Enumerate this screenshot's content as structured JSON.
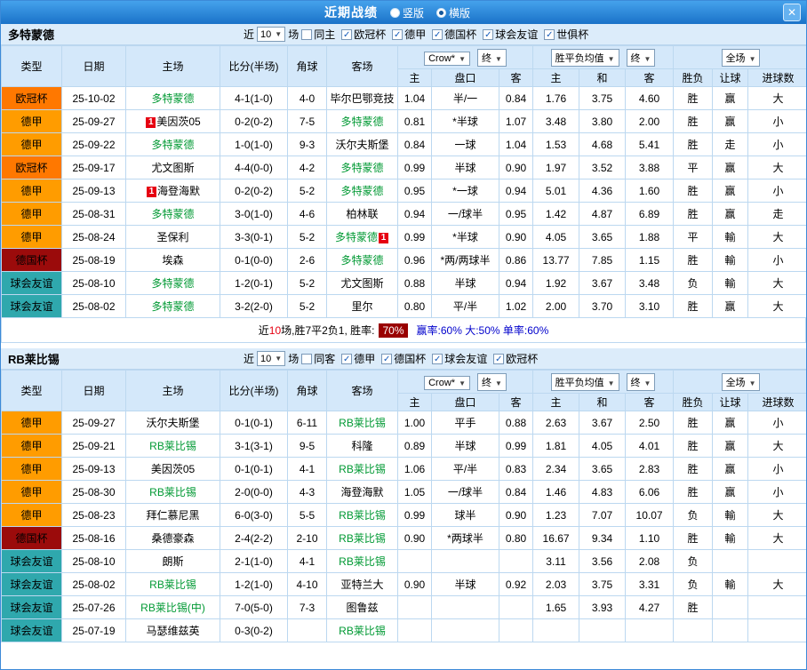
{
  "window": {
    "title": "近期战绩",
    "close_label": "✕",
    "view_options": [
      {
        "label": "竖版",
        "selected": false
      },
      {
        "label": "横版",
        "selected": true
      }
    ]
  },
  "league_colors": {
    "欧冠杯": "#ff7800",
    "德甲": "#ff9c00",
    "德国杯": "#9b0b0b",
    "球会友谊": "#2fa8ad"
  },
  "columns": [
    "类型",
    "日期",
    "主场",
    "比分(半场)",
    "角球",
    "客场",
    "主",
    "盘口",
    "客",
    "主",
    "和",
    "客",
    "胜负",
    "让球",
    "进球数"
  ],
  "dropdowns": [
    "Crow*",
    "终",
    "胜平负均值",
    "终",
    "全场"
  ],
  "filter": {
    "near_label": "近",
    "count": "10",
    "games_label": "场"
  },
  "sections": [
    {
      "team": "多特蒙德",
      "filters": [
        {
          "label": "同主",
          "checked": false
        },
        {
          "label": "欧冠杯",
          "checked": true
        },
        {
          "label": "德甲",
          "checked": true
        },
        {
          "label": "德国杯",
          "checked": true
        },
        {
          "label": "球会友谊",
          "checked": true
        },
        {
          "label": "世俱杯",
          "checked": true
        }
      ],
      "rows": [
        {
          "league": "欧冠杯",
          "date": "25-10-02",
          "home": {
            "name": "多特蒙德",
            "focus": true
          },
          "score": "4-1(1-0)",
          "corners": "4-0",
          "away": {
            "name": "毕尔巴鄂竞技"
          },
          "odds": [
            "1.04",
            "半/一",
            "0.84"
          ],
          "mean": [
            "1.76",
            "3.75",
            "4.60"
          ],
          "results": [
            [
              "胜",
              "r"
            ],
            [
              "赢",
              "r"
            ],
            [
              "大",
              "r"
            ]
          ]
        },
        {
          "league": "德甲",
          "date": "25-09-27",
          "home": {
            "name": "美因茨05",
            "card_before": "1"
          },
          "score": "0-2(0-2)",
          "corners": "7-5",
          "away": {
            "name": "多特蒙德",
            "focus": true
          },
          "odds": [
            "0.81",
            "*半球",
            "1.07"
          ],
          "mean": [
            "3.48",
            "3.80",
            "2.00"
          ],
          "results": [
            [
              "胜",
              "r"
            ],
            [
              "赢",
              "r"
            ],
            [
              "小",
              "g"
            ]
          ]
        },
        {
          "league": "德甲",
          "date": "25-09-22",
          "home": {
            "name": "多特蒙德",
            "focus": true
          },
          "score": "1-0(1-0)",
          "corners": "9-3",
          "away": {
            "name": "沃尔夫斯堡"
          },
          "odds": [
            "0.84",
            "一球",
            "1.04"
          ],
          "mean": [
            "1.53",
            "4.68",
            "5.41"
          ],
          "results": [
            [
              "胜",
              "r"
            ],
            [
              "走",
              "b"
            ],
            [
              "小",
              "g"
            ]
          ]
        },
        {
          "league": "欧冠杯",
          "date": "25-09-17",
          "home": {
            "name": "尤文图斯"
          },
          "score": "4-4(0-0)",
          "corners": "4-2",
          "away": {
            "name": "多特蒙德",
            "focus": true
          },
          "odds": [
            "0.99",
            "半球",
            "0.90"
          ],
          "mean": [
            "1.97",
            "3.52",
            "3.88"
          ],
          "results": [
            [
              "平",
              "b"
            ],
            [
              "赢",
              "r"
            ],
            [
              "大",
              "r"
            ]
          ]
        },
        {
          "league": "德甲",
          "date": "25-09-13",
          "home": {
            "name": "海登海默",
            "card_before": "1"
          },
          "score": "0-2(0-2)",
          "corners": "5-2",
          "away": {
            "name": "多特蒙德",
            "focus": true
          },
          "odds": [
            "0.95",
            "*一球",
            "0.94"
          ],
          "mean": [
            "5.01",
            "4.36",
            "1.60"
          ],
          "results": [
            [
              "胜",
              "r"
            ],
            [
              "赢",
              "r"
            ],
            [
              "小",
              "g"
            ]
          ]
        },
        {
          "league": "德甲",
          "date": "25-08-31",
          "home": {
            "name": "多特蒙德",
            "focus": true
          },
          "score": "3-0(1-0)",
          "corners": "4-6",
          "away": {
            "name": "柏林联"
          },
          "odds": [
            "0.94",
            "一/球半",
            "0.95"
          ],
          "mean": [
            "1.42",
            "4.87",
            "6.89"
          ],
          "results": [
            [
              "胜",
              "r"
            ],
            [
              "赢",
              "r"
            ],
            [
              "走",
              "b"
            ]
          ]
        },
        {
          "league": "德甲",
          "date": "25-08-24",
          "home": {
            "name": "圣保利"
          },
          "score": "3-3(0-1)",
          "corners": "5-2",
          "away": {
            "name": "多特蒙德",
            "focus": true,
            "card_after": "1"
          },
          "odds": [
            "0.99",
            "*半球",
            "0.90"
          ],
          "mean": [
            "4.05",
            "3.65",
            "1.88"
          ],
          "results": [
            [
              "平",
              "b"
            ],
            [
              "輸",
              "g"
            ],
            [
              "大",
              "r"
            ]
          ]
        },
        {
          "league": "德国杯",
          "date": "25-08-19",
          "home": {
            "name": "埃森"
          },
          "score": "0-1(0-0)",
          "corners": "2-6",
          "away": {
            "name": "多特蒙德",
            "focus": true
          },
          "odds": [
            "0.96",
            "*两/两球半",
            "0.86"
          ],
          "mean": [
            "13.77",
            "7.85",
            "1.15"
          ],
          "results": [
            [
              "胜",
              "r"
            ],
            [
              "輸",
              "g"
            ],
            [
              "小",
              "g"
            ]
          ]
        },
        {
          "league": "球会友谊",
          "date": "25-08-10",
          "home": {
            "name": "多特蒙德",
            "focus": true
          },
          "score": "1-2(0-1)",
          "corners": "5-2",
          "away": {
            "name": "尤文图斯"
          },
          "odds": [
            "0.88",
            "半球",
            "0.94"
          ],
          "mean": [
            "1.92",
            "3.67",
            "3.48"
          ],
          "results": [
            [
              "负",
              "g"
            ],
            [
              "輸",
              "g"
            ],
            [
              "大",
              "r"
            ]
          ]
        },
        {
          "league": "球会友谊",
          "date": "25-08-02",
          "home": {
            "name": "多特蒙德",
            "focus": true
          },
          "score": "3-2(2-0)",
          "corners": "5-2",
          "away": {
            "name": "里尔"
          },
          "odds": [
            "0.80",
            "平/半",
            "1.02"
          ],
          "mean": [
            "2.00",
            "3.70",
            "3.10"
          ],
          "results": [
            [
              "胜",
              "r"
            ],
            [
              "赢",
              "r"
            ],
            [
              "大",
              "r"
            ]
          ]
        }
      ],
      "summary": {
        "pre": "近",
        "count": "10",
        "mid": "场,胜7平2负1, 胜率:",
        "rate": "70%",
        "post": "赢率:60% 大:50% 单率:60%"
      }
    },
    {
      "team": "RB莱比锡",
      "filters": [
        {
          "label": "同客",
          "checked": false
        },
        {
          "label": "德甲",
          "checked": true
        },
        {
          "label": "德国杯",
          "checked": true
        },
        {
          "label": "球会友谊",
          "checked": true
        },
        {
          "label": "欧冠杯",
          "checked": true
        }
      ],
      "rows": [
        {
          "league": "德甲",
          "date": "25-09-27",
          "home": {
            "name": "沃尔夫斯堡"
          },
          "score": "0-1(0-1)",
          "corners": "6-11",
          "away": {
            "name": "RB莱比锡",
            "focus": true
          },
          "odds": [
            "1.00",
            "平手",
            "0.88"
          ],
          "mean": [
            "2.63",
            "3.67",
            "2.50"
          ],
          "results": [
            [
              "胜",
              "r"
            ],
            [
              "赢",
              "r"
            ],
            [
              "小",
              "g"
            ]
          ]
        },
        {
          "league": "德甲",
          "date": "25-09-21",
          "home": {
            "name": "RB莱比锡",
            "focus": true
          },
          "score": "3-1(3-1)",
          "corners": "9-5",
          "away": {
            "name": "科隆"
          },
          "odds": [
            "0.89",
            "半球",
            "0.99"
          ],
          "mean": [
            "1.81",
            "4.05",
            "4.01"
          ],
          "results": [
            [
              "胜",
              "r"
            ],
            [
              "赢",
              "r"
            ],
            [
              "大",
              "r"
            ]
          ]
        },
        {
          "league": "德甲",
          "date": "25-09-13",
          "home": {
            "name": "美因茨05"
          },
          "score": "0-1(0-1)",
          "corners": "4-1",
          "away": {
            "name": "RB莱比锡",
            "focus": true
          },
          "odds": [
            "1.06",
            "平/半",
            "0.83"
          ],
          "mean": [
            "2.34",
            "3.65",
            "2.83"
          ],
          "results": [
            [
              "胜",
              "r"
            ],
            [
              "赢",
              "r"
            ],
            [
              "小",
              "g"
            ]
          ]
        },
        {
          "league": "德甲",
          "date": "25-08-30",
          "home": {
            "name": "RB莱比锡",
            "focus": true
          },
          "score": "2-0(0-0)",
          "corners": "4-3",
          "away": {
            "name": "海登海默"
          },
          "odds": [
            "1.05",
            "一/球半",
            "0.84"
          ],
          "mean": [
            "1.46",
            "4.83",
            "6.06"
          ],
          "results": [
            [
              "胜",
              "r"
            ],
            [
              "赢",
              "r"
            ],
            [
              "小",
              "g"
            ]
          ]
        },
        {
          "league": "德甲",
          "date": "25-08-23",
          "home": {
            "name": "拜仁慕尼黑"
          },
          "score": "6-0(3-0)",
          "corners": "5-5",
          "away": {
            "name": "RB莱比锡",
            "focus": true
          },
          "odds": [
            "0.99",
            "球半",
            "0.90"
          ],
          "mean": [
            "1.23",
            "7.07",
            "10.07"
          ],
          "results": [
            [
              "负",
              "g"
            ],
            [
              "輸",
              "g"
            ],
            [
              "大",
              "r"
            ]
          ]
        },
        {
          "league": "德国杯",
          "date": "25-08-16",
          "home": {
            "name": "桑德豪森"
          },
          "score": "2-4(2-2)",
          "corners": "2-10",
          "away": {
            "name": "RB莱比锡",
            "focus": true
          },
          "odds": [
            "0.90",
            "*两球半",
            "0.80"
          ],
          "mean": [
            "16.67",
            "9.34",
            "1.10"
          ],
          "results": [
            [
              "胜",
              "r"
            ],
            [
              "輸",
              "g"
            ],
            [
              "大",
              "r"
            ]
          ]
        },
        {
          "league": "球会友谊",
          "date": "25-08-10",
          "home": {
            "name": "朗斯"
          },
          "score": "2-1(1-0)",
          "corners": "4-1",
          "away": {
            "name": "RB莱比锡",
            "focus": true
          },
          "odds": [
            "",
            "",
            ""
          ],
          "mean": [
            "3.11",
            "3.56",
            "2.08"
          ],
          "results": [
            [
              "负",
              "g"
            ],
            [
              "",
              ""
            ],
            [
              "",
              ""
            ]
          ]
        },
        {
          "league": "球会友谊",
          "date": "25-08-02",
          "home": {
            "name": "RB莱比锡",
            "focus": true
          },
          "score": "1-2(1-0)",
          "corners": "4-10",
          "away": {
            "name": "亚特兰大"
          },
          "odds": [
            "0.90",
            "半球",
            "0.92"
          ],
          "mean": [
            "2.03",
            "3.75",
            "3.31"
          ],
          "results": [
            [
              "负",
              "g"
            ],
            [
              "輸",
              "g"
            ],
            [
              "大",
              "r"
            ]
          ]
        },
        {
          "league": "球会友谊",
          "date": "25-07-26",
          "home": {
            "name": "RB莱比锡(中)",
            "focus": true
          },
          "score": "7-0(5-0)",
          "corners": "7-3",
          "away": {
            "name": "图鲁兹"
          },
          "odds": [
            "",
            "",
            ""
          ],
          "mean": [
            "1.65",
            "3.93",
            "4.27"
          ],
          "results": [
            [
              "胜",
              "r"
            ],
            [
              "",
              ""
            ],
            [
              "",
              ""
            ]
          ]
        },
        {
          "league": "球会友谊",
          "date": "25-07-19",
          "home": {
            "name": "马瑟维兹英"
          },
          "score": "0-3(0-2)",
          "corners": "",
          "away": {
            "name": "RB莱比锡",
            "focus": true
          },
          "odds": [
            "",
            "",
            ""
          ],
          "mean": [
            "",
            "",
            ""
          ],
          "results": [
            [
              "",
              ""
            ],
            [
              "",
              ""
            ],
            [
              "",
              ""
            ]
          ]
        }
      ],
      "summary": null
    }
  ]
}
